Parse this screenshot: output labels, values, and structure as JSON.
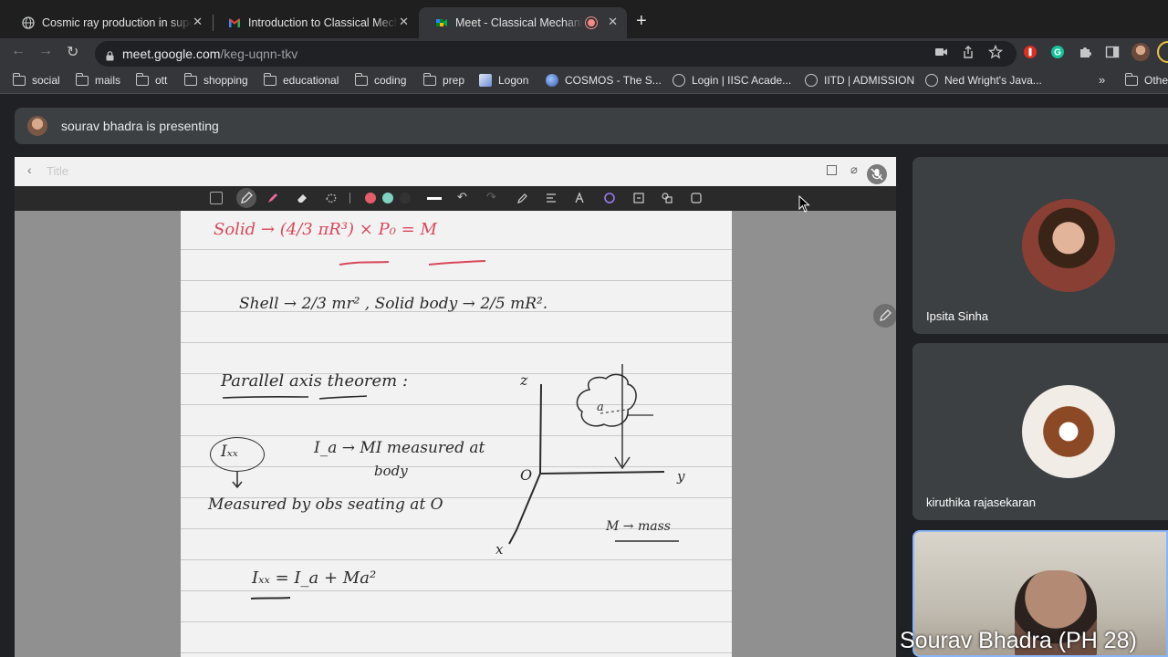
{
  "browser": {
    "tabs": [
      {
        "title": "Cosmic ray production in supe",
        "icon": "globe-icon",
        "active": false
      },
      {
        "title": "Introduction to Classical Mech",
        "icon": "gmail-icon",
        "active": false
      },
      {
        "title": "Meet - Classical Mechanics",
        "icon": "meet-icon",
        "active": true
      }
    ],
    "url_host": "meet.google.com",
    "url_path": "/keg-uqnn-tkv",
    "bookmarks": [
      {
        "label": "social",
        "type": "folder"
      },
      {
        "label": "mails",
        "type": "folder"
      },
      {
        "label": "ott",
        "type": "folder"
      },
      {
        "label": "shopping",
        "type": "folder"
      },
      {
        "label": "educational",
        "type": "folder"
      },
      {
        "label": "coding",
        "type": "folder"
      },
      {
        "label": "prep",
        "type": "folder"
      },
      {
        "label": "Logon",
        "type": "site"
      },
      {
        "label": "COSMOS - The S...",
        "type": "site"
      },
      {
        "label": "Login | IISC Acade...",
        "type": "site"
      },
      {
        "label": "IITD | ADMISSION",
        "type": "site"
      },
      {
        "label": "Ned Wright's Java...",
        "type": "site"
      }
    ],
    "bookmarks_overflow": "»",
    "other_bookmarks": "Othe"
  },
  "meet": {
    "presenting_text": "sourav bhadra is presenting",
    "whiteboard_title_placeholder": "Title",
    "participants": [
      {
        "name": "Ipsita Sinha"
      },
      {
        "name": "kiruthika rajasekaran"
      },
      {
        "name": "Sourav Bhadra (PH 28)"
      }
    ]
  },
  "notes": {
    "line_solid": "Solid → (4/3 πR³) × P₀ = M",
    "line_shell": "Shell → 2/3 mr²  ,   Solid body → 2/5 mR².",
    "line_heading": "Parallel axis theorem :",
    "line_ixx": "Iₓₓ",
    "line_ia": "I_a → MI measured at",
    "line_body": "body",
    "line_measured": "Measured by obs seating at O",
    "line_eq": "Iₓₓ = I_a + Ma²",
    "diag_z": "z",
    "diag_o": "O",
    "diag_y": "y",
    "diag_x": "x",
    "diag_a": "a",
    "diag_mass": "M → mass"
  },
  "colors": {
    "accent": "#8ab4f8",
    "ink_red": "#d9475a",
    "ink": "#2b2b2b"
  }
}
